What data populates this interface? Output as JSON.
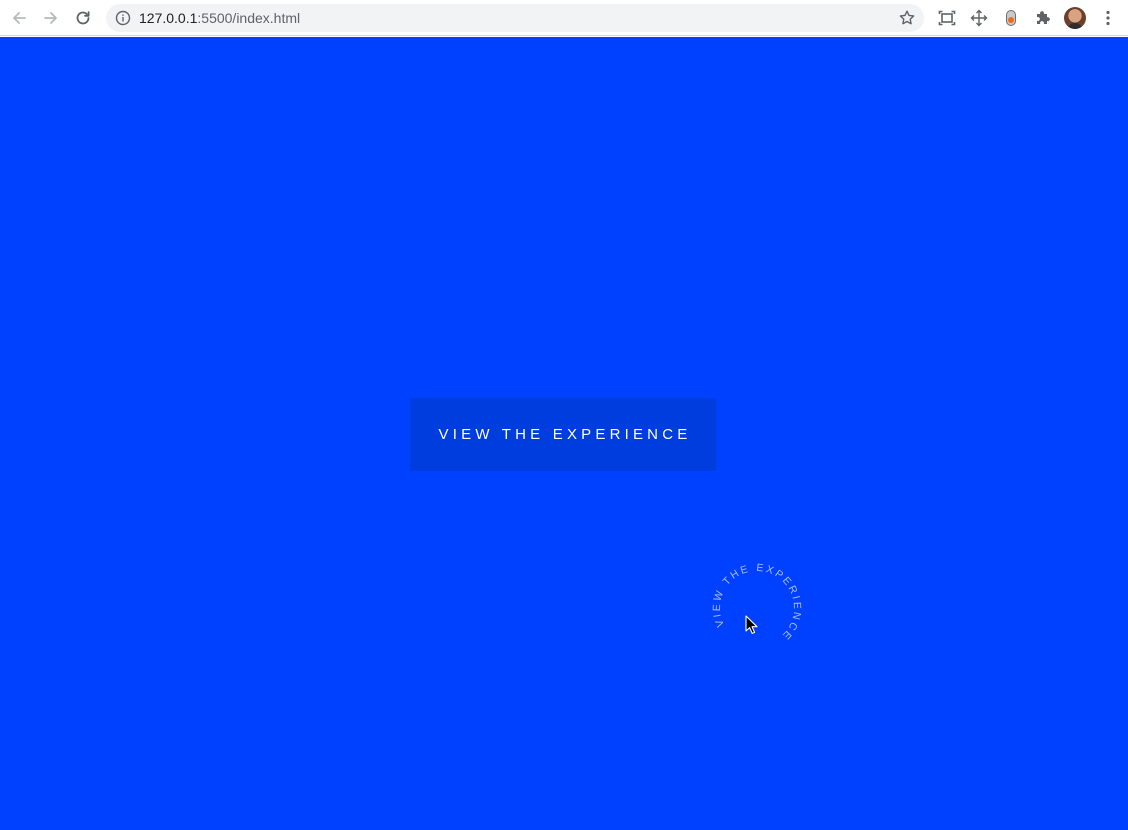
{
  "browser": {
    "url_host": "127.0.0.1",
    "url_path": ":5500/index.html",
    "icons": [
      "back-icon",
      "forward-icon",
      "reload-icon",
      "info-icon",
      "star-icon",
      "screen-capture-icon",
      "move-icon",
      "extension-icon",
      "puzzle-icon",
      "avatar",
      "kebab-menu-icon"
    ]
  },
  "page": {
    "background_color": "#0041ff",
    "button_color": "#003ddf",
    "button_label": "VIEW THE EXPERIENCE",
    "circle_text": "VIEW THE EXPERIENCE"
  }
}
